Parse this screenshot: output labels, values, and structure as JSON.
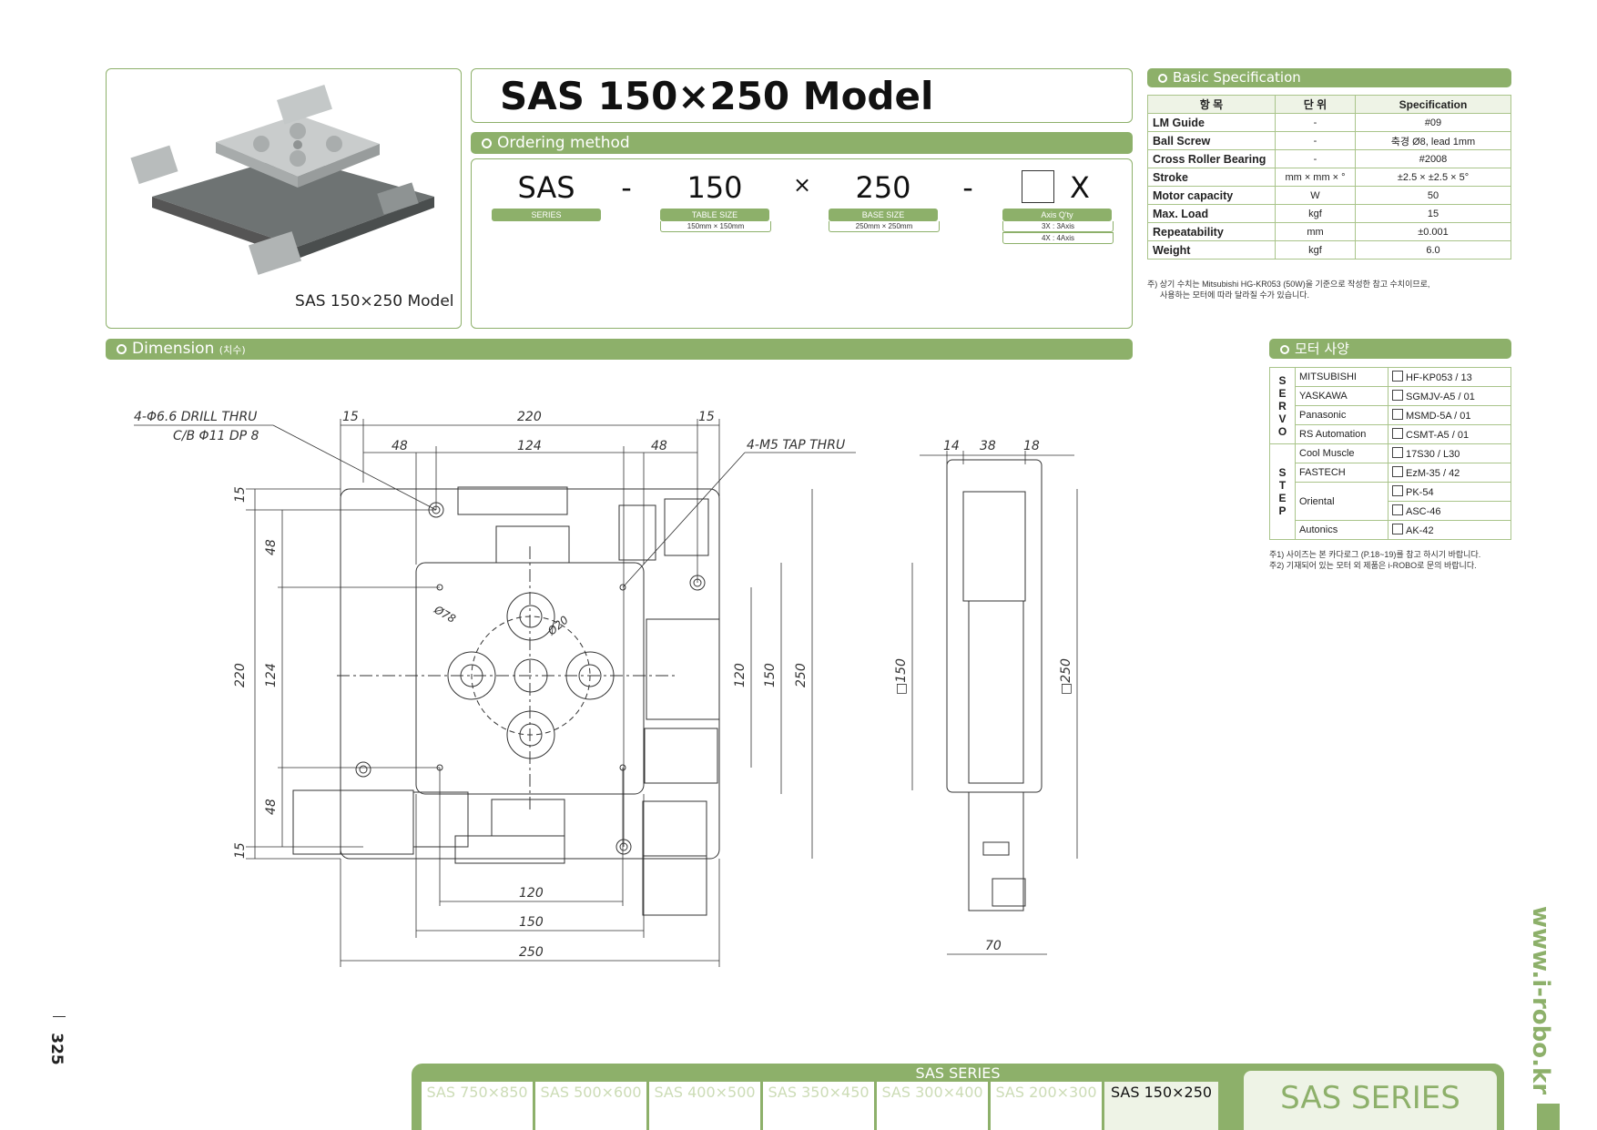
{
  "model_title": "SAS 150×250 Model",
  "photo_caption": "SAS 150×250 Model",
  "sections": {
    "ordering": "Ordering method",
    "basic_spec": "Basic Specification",
    "dimension": "Dimension",
    "dimension_kr": "(치수)",
    "motor": "모터 사양"
  },
  "ordering": {
    "series": "SAS",
    "dash1": "-",
    "table_size": "150",
    "times": "×",
    "base_size": "250",
    "dash2": "-",
    "axis": "X",
    "series_label": "SERIES",
    "table_size_label": "TABLE SIZE",
    "table_size_sub": "150mm × 150mm",
    "base_size_label": "BASE SIZE",
    "base_size_sub": "250mm × 250mm",
    "axis_label": "Axis Q'ty",
    "axis_opt1": "3X : 3Axis",
    "axis_opt2": "4X : 4Axis"
  },
  "spec": {
    "headers": [
      "항 목",
      "단 위",
      "Specification"
    ],
    "rows": [
      [
        "LM Guide",
        "-",
        "#09"
      ],
      [
        "Ball Screw",
        "-",
        "축경 Ø8, lead 1mm"
      ],
      [
        "Cross Roller Bearing",
        "-",
        "#2008"
      ],
      [
        "Stroke",
        "mm × mm × °",
        "±2.5 × ±2.5 × 5°"
      ],
      [
        "Motor capacity",
        "W",
        "50"
      ],
      [
        "Max. Load",
        "kgf",
        "15"
      ],
      [
        "Repeatability",
        "mm",
        "±0.001"
      ],
      [
        "Weight",
        "kgf",
        "6.0"
      ]
    ],
    "note1": "주) 상기 수치는 Mitsubishi HG-KR053 (50W)을 기준으로 작성한 참고 수치이므로,",
    "note2": "사용하는 모터에 따라 달라질 수가 있습니다."
  },
  "motor": {
    "servo_letters": [
      "S",
      "E",
      "R",
      "V",
      "O"
    ],
    "step_letters": [
      "S",
      "T",
      "E",
      "P"
    ],
    "servo": [
      [
        "MITSUBISHI",
        "HF-KP053 / 13"
      ],
      [
        "YASKAWA",
        "SGMJV-A5 / 01"
      ],
      [
        "Panasonic",
        "MSMD-5A / 01"
      ],
      [
        "RS Automation",
        "CSMT-A5 / 01"
      ]
    ],
    "step": [
      [
        "Cool Muscle",
        "17S30 / L30"
      ],
      [
        "FASTECH",
        "EzM-35 / 42"
      ],
      [
        "Oriental",
        "PK-54"
      ],
      [
        "",
        "ASC-46"
      ],
      [
        "Autonics",
        "AK-42"
      ]
    ],
    "note1": "주1) 사이즈는 본 카다로그 (P.18~19)를 참고 하시기 바랍니다.",
    "note2": "주2) 기재되어 있는 모터 외 제품은 i-ROBO로 문의 바랍니다."
  },
  "dimensions": {
    "drill": "4-Φ6.6 DRILL THRU",
    "cb": "C/B Φ11 DP 8",
    "tap": "4-M5 TAP THRU",
    "d15a": "15",
    "d220": "220",
    "d15b": "15",
    "d48a": "48",
    "d124": "124",
    "d48b": "48",
    "l15a": "15",
    "l48a": "48",
    "l220": "220",
    "l124": "124",
    "l48b": "48",
    "l15b": "15",
    "r120": "120",
    "r150": "150",
    "r250": "250",
    "b120": "120",
    "b150": "150",
    "b250": "250",
    "phi78": "Ø78",
    "phi20": "Ø20",
    "s14": "14",
    "s38": "38",
    "s18": "18",
    "sq150": "□150",
    "sq250": "□250",
    "s70": "70"
  },
  "page_number": "325",
  "website": "www.i-robo.kr",
  "footer": {
    "series_title": "SAS SERIES",
    "tabs": [
      "SAS 750×850",
      "SAS 500×600",
      "SAS 400×500",
      "SAS 350×450",
      "SAS 300×400",
      "SAS 200×300",
      "SAS 150×250"
    ],
    "brand": "SAS SERIES"
  },
  "colors": {
    "accent": "#8db06a",
    "accent_light": "#eef3e6",
    "text": "#222222"
  }
}
